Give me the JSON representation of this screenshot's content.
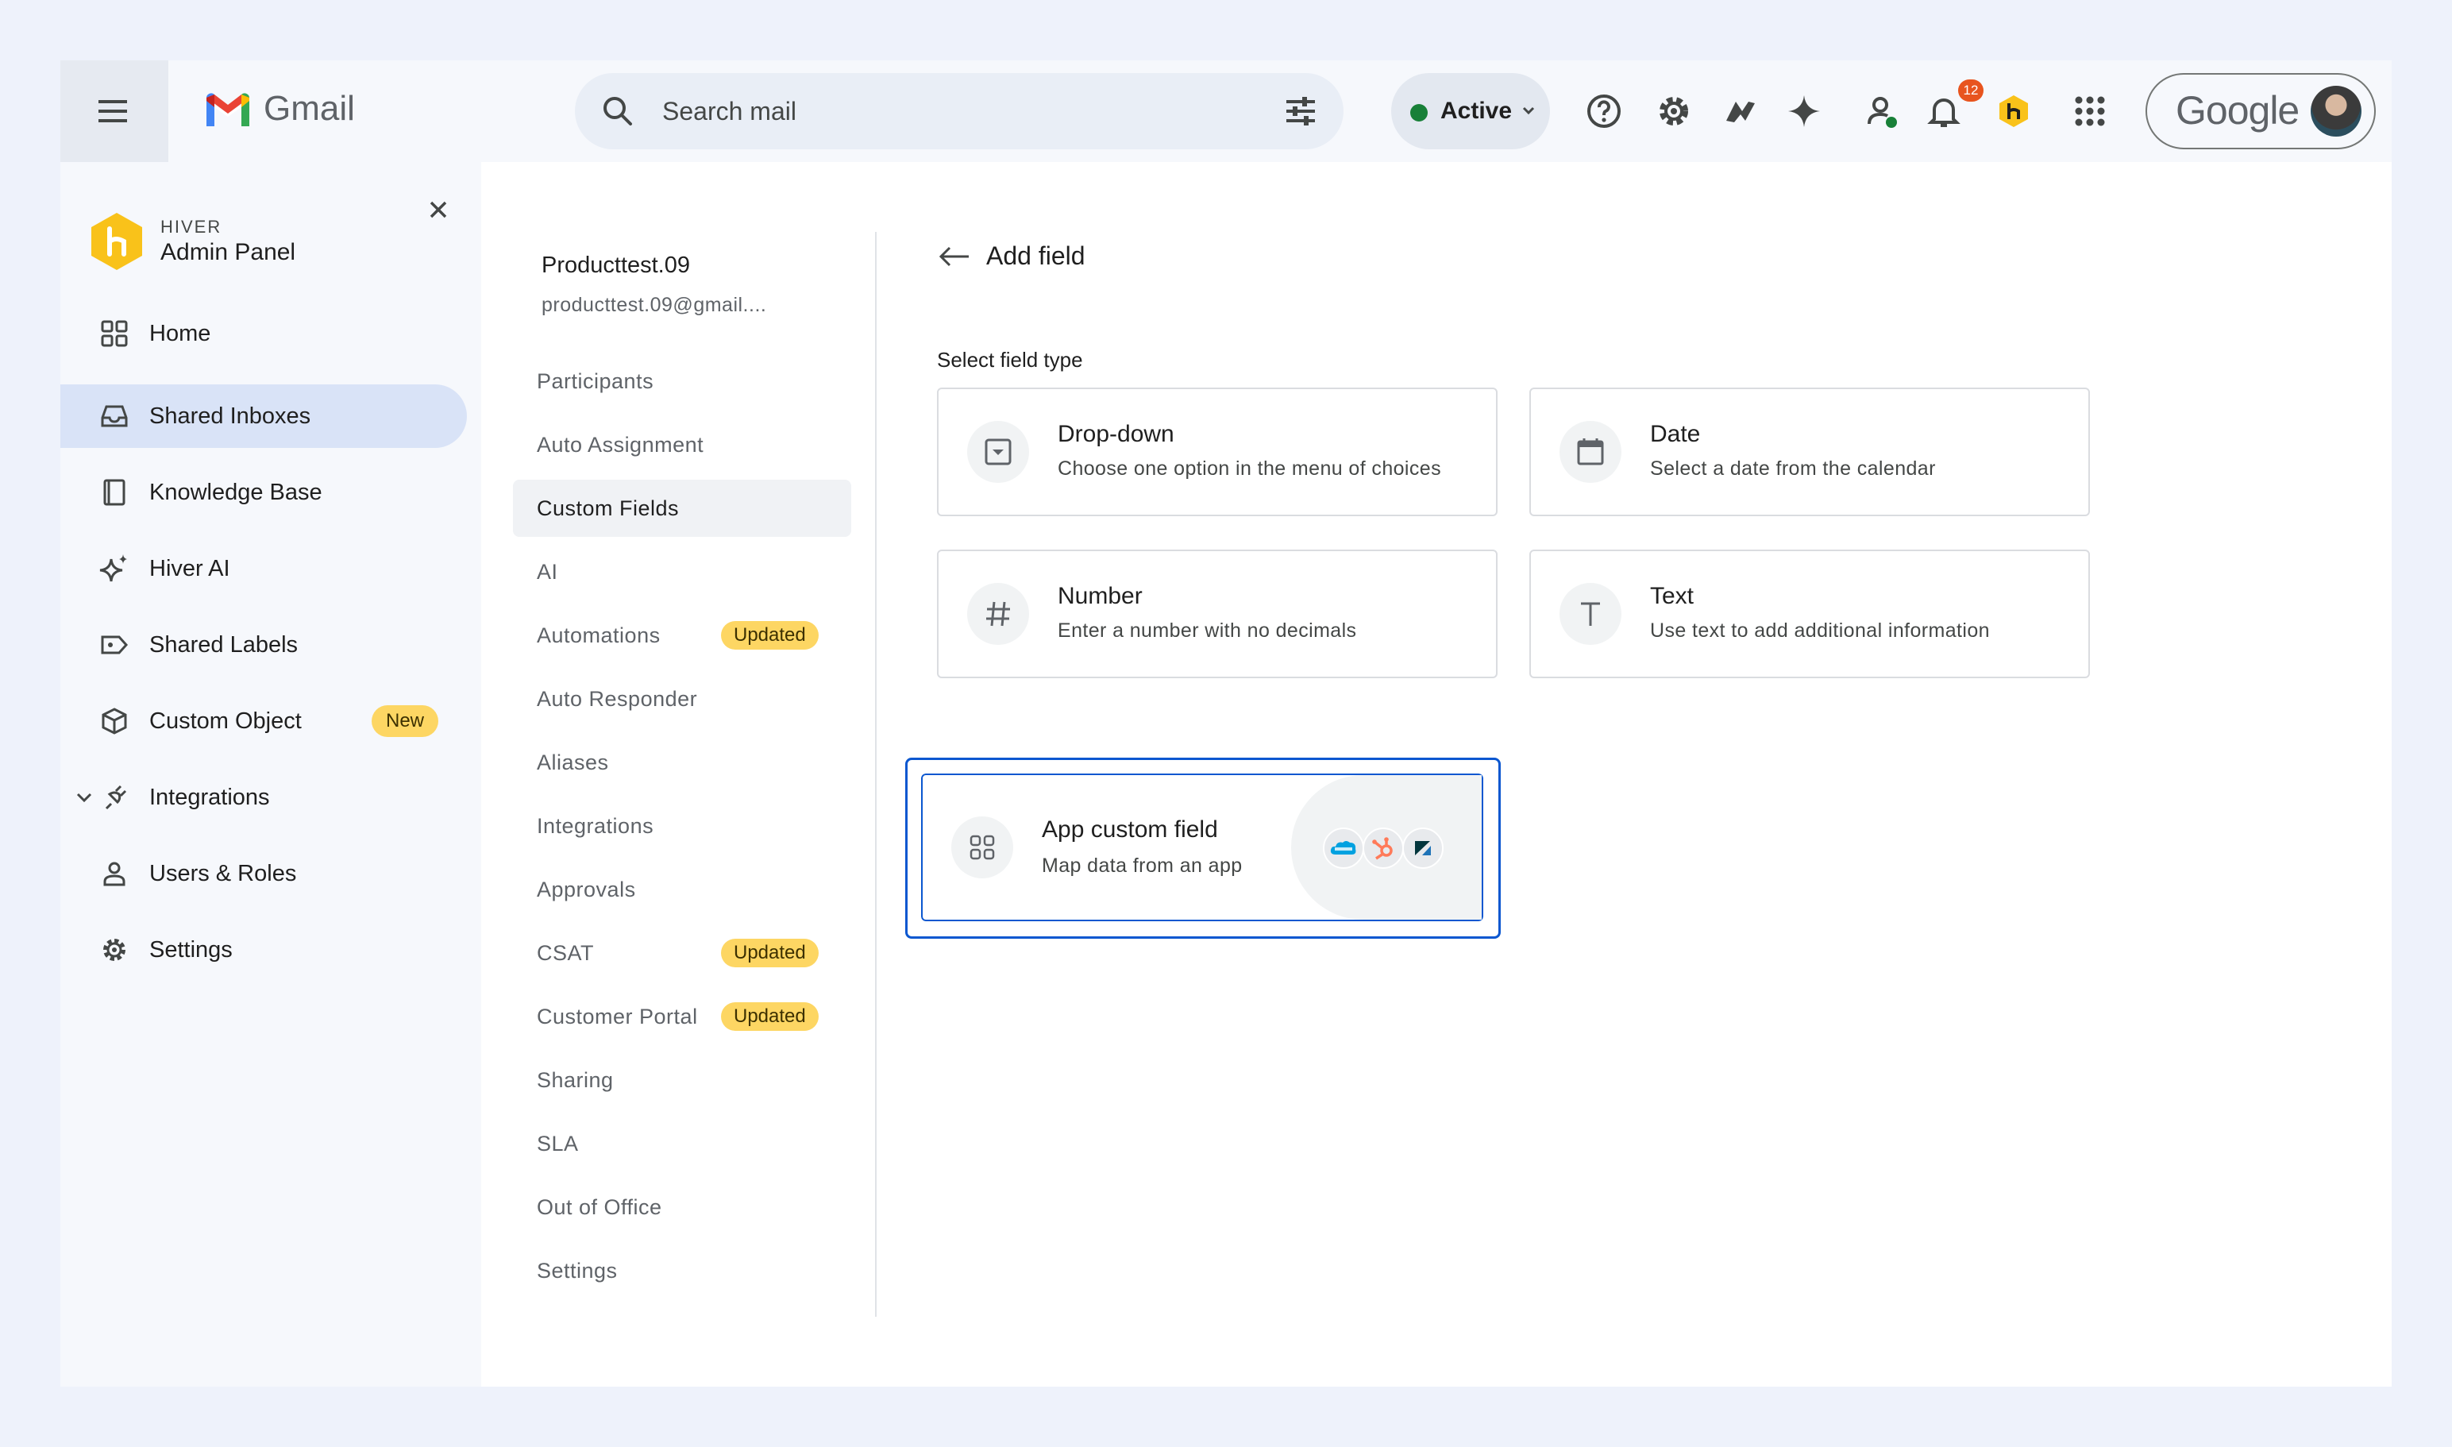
{
  "topbar": {
    "app_name": "Gmail",
    "search_placeholder": "Search mail",
    "status_label": "Active",
    "notification_count": "12",
    "account_label": "Google"
  },
  "sidebar": {
    "brand_sub": "HIVER",
    "brand_title": "Admin Panel",
    "items": [
      {
        "label": "Home",
        "icon": "grid-icon"
      },
      {
        "label": "Shared Inboxes",
        "icon": "inbox-icon",
        "active": true
      },
      {
        "label": "Knowledge Base",
        "icon": "book-icon"
      },
      {
        "label": "Hiver AI",
        "icon": "sparkle-icon"
      },
      {
        "label": "Shared Labels",
        "icon": "label-icon"
      },
      {
        "label": "Custom Object",
        "icon": "cube-icon",
        "badge": "New"
      },
      {
        "label": "Integrations",
        "icon": "plug-icon"
      },
      {
        "label": "Users & Roles",
        "icon": "person-icon"
      },
      {
        "label": "Settings",
        "icon": "gear-icon"
      }
    ]
  },
  "inbox": {
    "name": "Producttest.09",
    "email": "producttest.09@gmail...."
  },
  "subnav": [
    {
      "label": "Participants"
    },
    {
      "label": "Auto Assignment"
    },
    {
      "label": "Custom Fields",
      "active": true
    },
    {
      "label": "AI"
    },
    {
      "label": "Automations",
      "badge": "Updated"
    },
    {
      "label": "Auto Responder"
    },
    {
      "label": "Aliases"
    },
    {
      "label": "Integrations"
    },
    {
      "label": "Approvals"
    },
    {
      "label": "CSAT",
      "badge": "Updated"
    },
    {
      "label": "Customer Portal",
      "badge": "Updated"
    },
    {
      "label": "Sharing"
    },
    {
      "label": "SLA"
    },
    {
      "label": "Out of Office"
    },
    {
      "label": "Settings"
    }
  ],
  "main": {
    "title": "Add field",
    "section_label": "Select field type",
    "cards": [
      {
        "title": "Drop-down",
        "desc": "Choose one option in the menu of choices",
        "icon": "dropdown-icon"
      },
      {
        "title": "Date",
        "desc": "Select a date from the calendar",
        "icon": "calendar-icon"
      },
      {
        "title": "Number",
        "desc": "Enter a number with no decimals",
        "icon": "hash-icon"
      },
      {
        "title": "Text",
        "desc": "Use text to add additional information",
        "icon": "text-icon"
      },
      {
        "title": "App custom field",
        "desc": "Map data from an app",
        "icon": "apps-icon",
        "selected": true
      }
    ],
    "app_logos": [
      "salesforce-logo",
      "hubspot-logo",
      "zendesk-logo"
    ]
  },
  "colors": {
    "accent": "#0b57d0",
    "active_nav": "#d9e3f7",
    "badge": "#fdd663",
    "hiver_yellow": "#f9c21a"
  }
}
